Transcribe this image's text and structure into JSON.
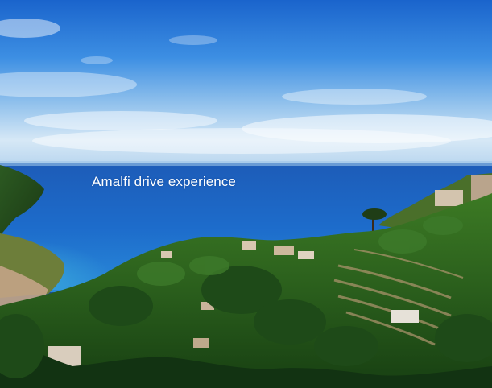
{
  "photo": {
    "caption": "Amalfi drive experience",
    "subject": "amalfi-coast-landscape",
    "colors": {
      "sky_top": "#1e6fd6",
      "sky_mid": "#4a9be8",
      "sky_haze": "#cfe3f4",
      "sea_far": "#1f66c2",
      "sea_near": "#1e78d4",
      "sea_shallow": "#2fa4d8",
      "hill_dark": "#123f16",
      "hill_mid": "#2f6a22",
      "hill_light": "#5f8f2c",
      "village": "#c9a98a",
      "caption_text": "#ffffff"
    }
  }
}
